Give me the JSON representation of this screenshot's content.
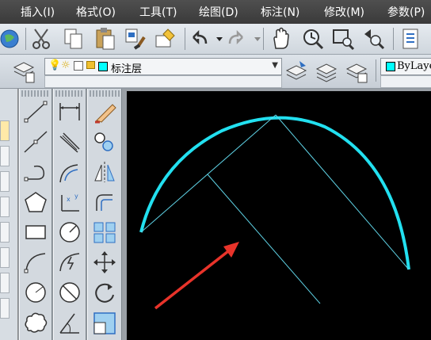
{
  "menubar": {
    "items": [
      {
        "label": "插入(I)"
      },
      {
        "label": "格式(O)"
      },
      {
        "label": "工具(T)"
      },
      {
        "label": "绘图(D)"
      },
      {
        "label": "标注(N)"
      },
      {
        "label": "修改(M)"
      },
      {
        "label": "参数(P)"
      }
    ]
  },
  "layer_toolbar": {
    "current_layer": "标注层",
    "color_control": "ByLaye"
  },
  "colors": {
    "arc": "#22e0f0",
    "guide_line": "#5fd3e6",
    "arrow": "#e8332a",
    "canvas_bg": "#000000",
    "layer_color": "#00ffff"
  }
}
